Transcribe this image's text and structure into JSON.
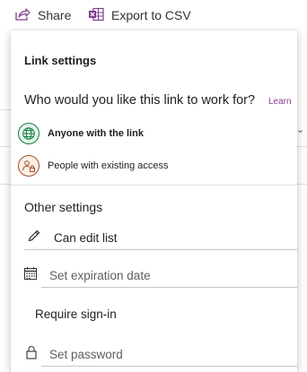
{
  "toolbar": {
    "share_label": "Share",
    "export_label": "Export to CSV",
    "icon_color": "#7a3b8c"
  },
  "panel": {
    "title": "Link settings",
    "question": "Who would you like this link to work for?",
    "learn_link": "Learn",
    "options": [
      {
        "label": "Anyone with the link",
        "icon": "globe-icon",
        "selected": true,
        "color": "#107c41"
      },
      {
        "label": "People with existing access",
        "icon": "people-lock-icon",
        "selected": false,
        "color": "#a0522d"
      }
    ],
    "other_settings_title": "Other settings",
    "can_edit_label": "Can edit list",
    "expiration_placeholder": "Set expiration date",
    "require_signin_label": "Require sign-in",
    "password_placeholder": "Set password"
  }
}
